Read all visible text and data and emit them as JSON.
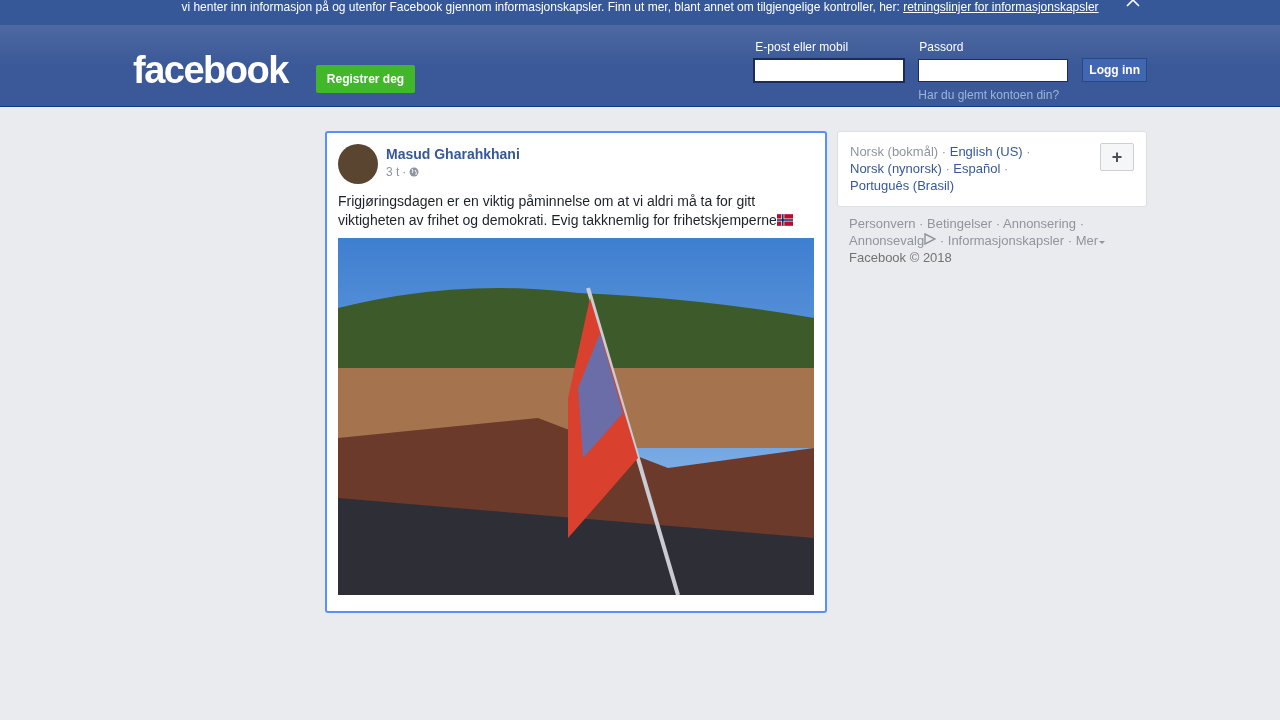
{
  "cookie_banner": {
    "text": "vi henter inn informasjon på og utenfor Facebook gjennom informasjonskapsler. Finn ut mer, blant annet om tilgjengelige kontroller, her:",
    "link": "retningslinjer for informasjonskapsler"
  },
  "header": {
    "logo": "facebook",
    "register_button": "Registrer deg",
    "email": {
      "label": "E-post eller mobil",
      "focused": true
    },
    "password": {
      "label": "Passord"
    },
    "login_button": "Logg inn",
    "forgot_link": "Har du glemt kontoen din?"
  },
  "post": {
    "author": "Masud Gharahkhani",
    "time": "3 t",
    "separator": "·",
    "text": "Frigjøringsdagen er en viktig påminnelse om at vi aldri må ta for gitt viktigheten av frihet og demokrati. Evig takknemlig for frihetskjemperne"
  },
  "languages": {
    "separator": "·",
    "items": [
      {
        "label": "Norsk (bokmål)",
        "selected": true
      },
      {
        "label": "English (US)",
        "selected": false
      },
      {
        "label": "Norsk (nynorsk)",
        "selected": false
      },
      {
        "label": "Español",
        "selected": false
      },
      {
        "label": "Português (Brasil)",
        "selected": false
      }
    ],
    "add_button": "+"
  },
  "footer": {
    "separator": "·",
    "links": [
      "Personvern",
      "Betingelser",
      "Annonsering",
      "Annonsevalg",
      "Informasjonskapsler",
      "Mer"
    ],
    "copyright": "Facebook © 2018"
  }
}
